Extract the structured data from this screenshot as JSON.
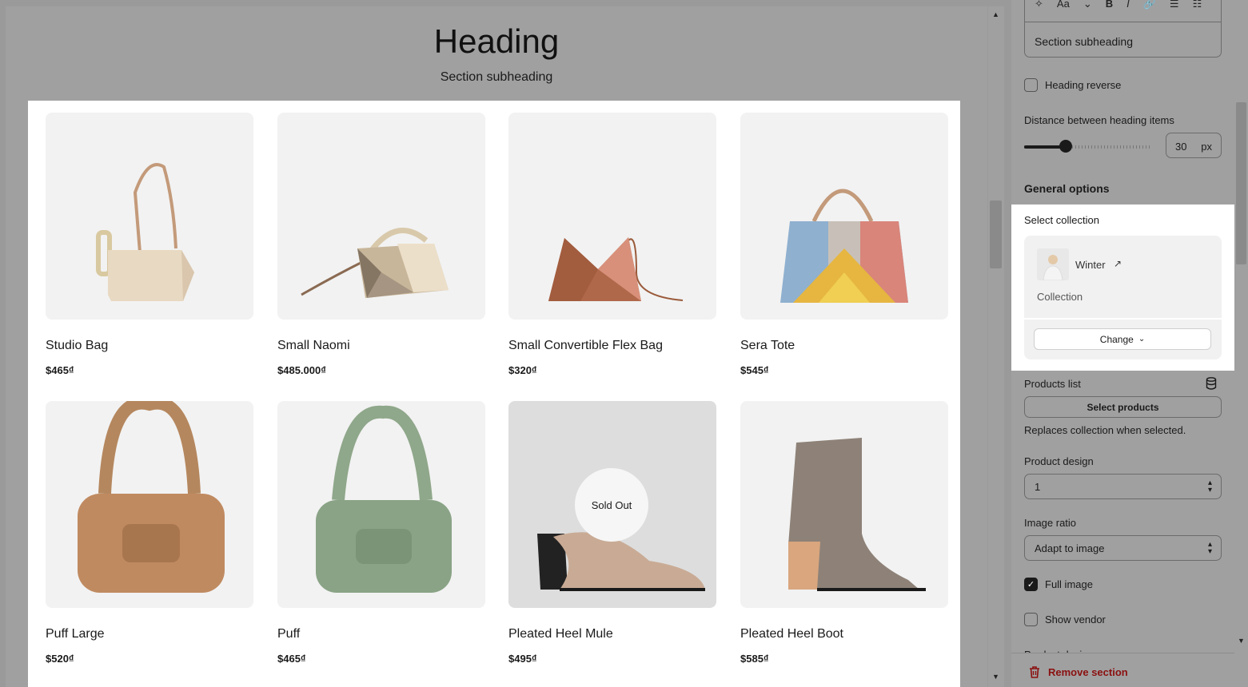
{
  "preview": {
    "heading": "Heading",
    "subheading": "Section subheading",
    "products": [
      {
        "title": "Studio Bag",
        "price": "$465₫",
        "sold_out": false
      },
      {
        "title": "Small Naomi",
        "price": "$485.000₫",
        "sold_out": false
      },
      {
        "title": "Small Convertible Flex Bag",
        "price": "$320₫",
        "sold_out": false
      },
      {
        "title": "Sera Tote",
        "price": "$545₫",
        "sold_out": false
      },
      {
        "title": "Puff Large",
        "price": "$520₫",
        "sold_out": false
      },
      {
        "title": "Puff",
        "price": "$465₫",
        "sold_out": false
      },
      {
        "title": "Pleated Heel Mule",
        "price": "$495₫",
        "sold_out": true
      },
      {
        "title": "Pleated Heel Boot",
        "price": "$585₫",
        "sold_out": false
      }
    ],
    "sold_out_label": "Sold Out"
  },
  "panel": {
    "rte_toolbar": [
      "✧",
      "Aa",
      "⌄",
      "B",
      "I",
      "🔗",
      "☰",
      "☷"
    ],
    "subheading_value": "Section subheading",
    "heading_reverse_label": "Heading reverse",
    "heading_reverse_checked": false,
    "distance_label": "Distance between heading items",
    "distance_value": "30",
    "distance_unit": "px",
    "general_options_title": "General options",
    "select_collection_label": "Select collection",
    "collection_name": "Winter",
    "collection_type": "Collection",
    "change_label": "Change",
    "products_list_label": "Products list",
    "select_products_label": "Select products",
    "products_help": "Replaces collection when selected.",
    "product_design_label": "Product design",
    "product_design_value": "1",
    "image_ratio_label": "Image ratio",
    "image_ratio_value": "Adapt to image",
    "full_image_label": "Full image",
    "full_image_checked": true,
    "show_vendor_label": "Show vendor",
    "show_vendor_checked": false,
    "next_label_cut": "Product design",
    "remove_section_label": "Remove section"
  },
  "colors": {
    "overlay_gray": "#a0a0a0",
    "card_bg": "#f2f2f2",
    "danger": "#8b1010"
  }
}
